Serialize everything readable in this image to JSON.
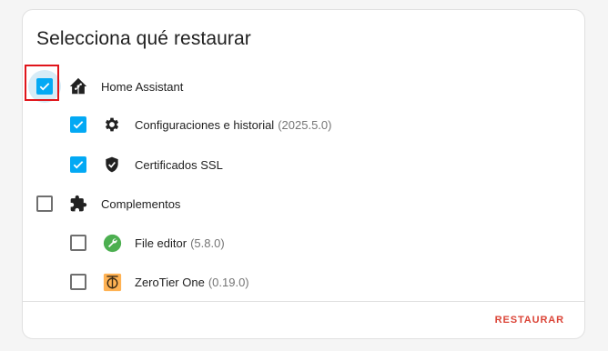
{
  "dialog": {
    "title": "Selecciona qué restaurar",
    "restore_button": "RESTAURAR"
  },
  "groups": [
    {
      "label": "Home Assistant",
      "checked": true,
      "icon": "home-assistant-icon",
      "items": [
        {
          "label": "Configuraciones e historial",
          "version": "(2025.5.0)",
          "checked": true,
          "icon": "gear-icon"
        },
        {
          "label": "Certificados SSL",
          "version": "",
          "checked": true,
          "icon": "shield-check-icon"
        }
      ]
    },
    {
      "label": "Complementos",
      "checked": false,
      "icon": "puzzle-icon",
      "items": [
        {
          "label": "File editor",
          "version": "(5.8.0)",
          "checked": false,
          "icon": "wrench-icon"
        },
        {
          "label": "ZeroTier One",
          "version": "(0.19.0)",
          "checked": false,
          "icon": "zerotier-icon"
        }
      ]
    }
  ],
  "colors": {
    "accent": "#03a9f4",
    "button_text": "#db4437",
    "focus_outline": "#e0151b",
    "file_editor_icon": "#4caf50",
    "zerotier_icon": "#ffb253"
  }
}
